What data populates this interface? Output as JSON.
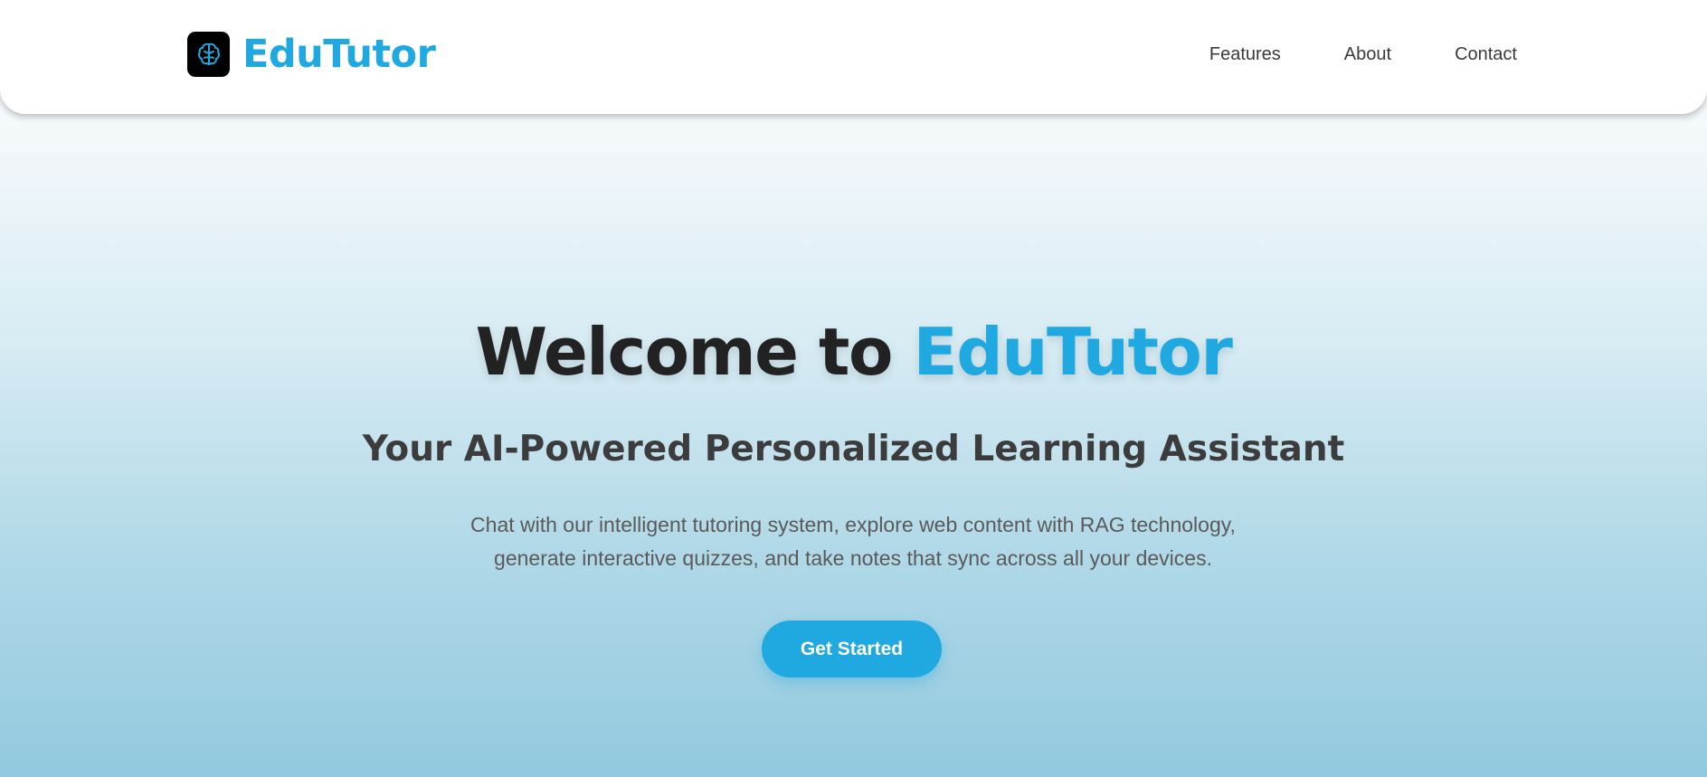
{
  "header": {
    "brand": "EduTutor",
    "logo_icon": "brain-icon",
    "nav": [
      {
        "label": "Features"
      },
      {
        "label": "About"
      },
      {
        "label": "Contact"
      }
    ]
  },
  "hero": {
    "title_prefix": "Welcome to ",
    "title_brand": "EduTutor",
    "subtitle": "Your AI-Powered Personalized Learning Assistant",
    "description_line1": "Chat with our intelligent tutoring system, explore web content with RAG technology,",
    "description_line2": "generate interactive quizzes, and take notes that sync across all your devices.",
    "cta_label": "Get Started"
  },
  "colors": {
    "brand": "#20a8e0",
    "heading": "#222222",
    "logo_background": "#000000"
  }
}
